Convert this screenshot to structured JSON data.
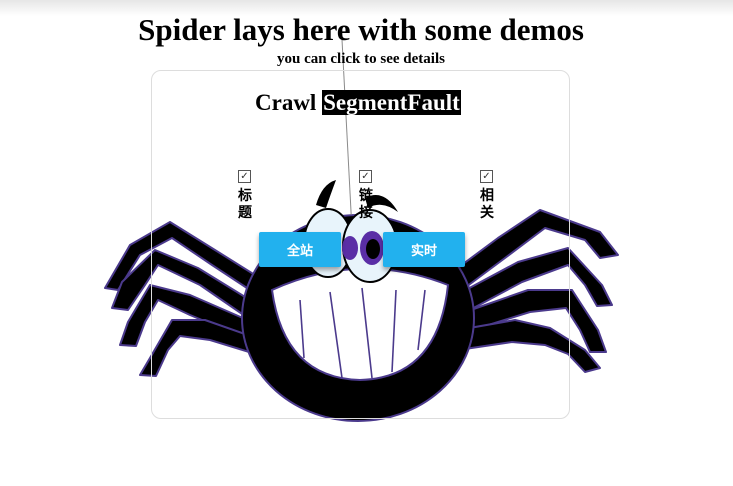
{
  "header": {
    "title": "Spider lays here with some demos",
    "subtitle": "you can click to see details"
  },
  "card": {
    "heading_prefix": "Crawl",
    "heading_highlight": "SegmentFault",
    "options": [
      {
        "label": "标题",
        "checked": true
      },
      {
        "label": "链接",
        "checked": true
      },
      {
        "label": "相关",
        "checked": true
      }
    ],
    "buttons": {
      "all_site": "全站",
      "realtime": "实时"
    }
  },
  "colors": {
    "button": "#22b1ee",
    "spider_body": "#000000",
    "spider_outline": "#4b3a8c"
  },
  "icons": {
    "checkbox": "check-icon",
    "mascot": "spider-mascot"
  }
}
